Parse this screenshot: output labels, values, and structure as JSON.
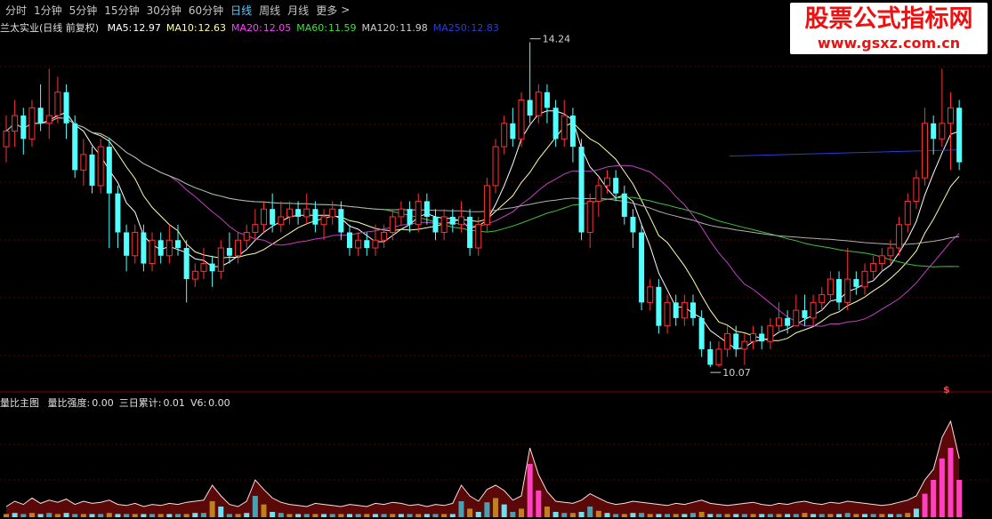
{
  "periods": [
    "分时",
    "1分钟",
    "5分钟",
    "15分钟",
    "30分钟",
    "60分钟",
    "日线",
    "周线",
    "月线",
    "更多"
  ],
  "active_period": "日线",
  "more_arrow": ">",
  "stock_title": "兰太实业(日线 前复权)",
  "ma": [
    {
      "label": "MA5:",
      "value": "12.97",
      "color": "#ffffff"
    },
    {
      "label": "MA10:",
      "value": "12.63",
      "color": "#ffffaa"
    },
    {
      "label": "MA20:",
      "value": "12.05",
      "color": "#ff40ff"
    },
    {
      "label": "MA60:",
      "value": "11.59",
      "color": "#40e040"
    },
    {
      "label": "MA120:",
      "value": "11.98",
      "color": "#d0d0d0"
    },
    {
      "label": "MA250:",
      "value": "12.83",
      "color": "#2a3fd0"
    }
  ],
  "high_mark": "14.24",
  "low_mark": "10.07",
  "indicator": {
    "name": "量比主图",
    "items": [
      {
        "label": "量比强度:",
        "value": "0.00"
      },
      {
        "label": "三日累计:",
        "value": "0.01"
      },
      {
        "label": "V6:",
        "value": "0.00"
      }
    ]
  },
  "signal_glyph": "$",
  "watermark": {
    "title": "股票公式指标网",
    "url": "www.gsxz.com.cn"
  },
  "chart_data": {
    "type": "candlestick",
    "price_axis": {
      "min": 9.9,
      "max": 14.35
    },
    "candles": [
      [
        12.9,
        13.1,
        13.3,
        12.7
      ],
      [
        13.1,
        13.3,
        13.5,
        12.9
      ],
      [
        13.3,
        13.0,
        13.4,
        12.8
      ],
      [
        13.0,
        13.4,
        13.5,
        12.9
      ],
      [
        13.4,
        13.2,
        13.7,
        13.1
      ],
      [
        13.2,
        13.3,
        13.9,
        13.0
      ],
      [
        13.3,
        13.6,
        13.8,
        13.2
      ],
      [
        13.6,
        13.2,
        13.7,
        13.0
      ],
      [
        13.2,
        12.6,
        13.3,
        12.5
      ],
      [
        12.6,
        12.8,
        13.0,
        12.4
      ],
      [
        12.8,
        12.4,
        12.9,
        12.3
      ],
      [
        12.4,
        12.9,
        13.0,
        12.3
      ],
      [
        12.9,
        12.3,
        13.0,
        11.6
      ],
      [
        12.3,
        11.8,
        12.4,
        11.6
      ],
      [
        11.8,
        11.5,
        11.9,
        11.3
      ],
      [
        11.5,
        11.8,
        11.9,
        11.4
      ],
      [
        11.8,
        11.4,
        11.9,
        11.3
      ],
      [
        11.4,
        11.7,
        11.8,
        11.3
      ],
      [
        11.7,
        11.5,
        11.8,
        11.4
      ],
      [
        11.5,
        11.7,
        11.9,
        11.4
      ],
      [
        11.7,
        11.6,
        11.9,
        11.5
      ],
      [
        11.6,
        11.2,
        11.7,
        10.9
      ],
      [
        11.2,
        11.3,
        11.4,
        11.1
      ],
      [
        11.3,
        11.4,
        11.6,
        11.2
      ],
      [
        11.4,
        11.3,
        11.5,
        11.1
      ],
      [
        11.3,
        11.6,
        11.7,
        11.2
      ],
      [
        11.6,
        11.5,
        11.8,
        11.4
      ],
      [
        11.5,
        11.7,
        11.8,
        11.4
      ],
      [
        11.7,
        11.8,
        11.9,
        11.6
      ],
      [
        11.8,
        11.9,
        12.1,
        11.7
      ],
      [
        11.9,
        12.1,
        12.2,
        11.8
      ],
      [
        12.1,
        11.9,
        12.3,
        11.8
      ],
      [
        11.9,
        12.0,
        12.2,
        11.8
      ],
      [
        12.0,
        12.1,
        12.2,
        11.9
      ],
      [
        12.1,
        12.0,
        12.2,
        11.9
      ],
      [
        12.0,
        12.1,
        12.3,
        11.9
      ],
      [
        12.1,
        11.9,
        12.2,
        11.8
      ],
      [
        11.9,
        12.0,
        12.1,
        11.7
      ],
      [
        12.0,
        12.1,
        12.2,
        11.9
      ],
      [
        12.1,
        11.8,
        12.2,
        11.7
      ],
      [
        11.8,
        11.6,
        11.9,
        11.5
      ],
      [
        11.6,
        11.7,
        11.8,
        11.5
      ],
      [
        11.7,
        11.6,
        11.8,
        11.5
      ],
      [
        11.6,
        11.7,
        11.9,
        11.5
      ],
      [
        11.7,
        11.8,
        11.9,
        11.6
      ],
      [
        11.8,
        12.0,
        12.1,
        11.7
      ],
      [
        12.0,
        12.1,
        12.2,
        11.9
      ],
      [
        12.1,
        11.9,
        12.2,
        11.8
      ],
      [
        11.9,
        12.2,
        12.3,
        11.8
      ],
      [
        12.2,
        12.0,
        12.3,
        11.9
      ],
      [
        12.0,
        11.8,
        12.1,
        11.7
      ],
      [
        11.8,
        12.0,
        12.1,
        11.7
      ],
      [
        12.0,
        11.9,
        12.1,
        11.8
      ],
      [
        11.9,
        12.0,
        12.2,
        11.8
      ],
      [
        12.0,
        11.6,
        12.1,
        11.5
      ],
      [
        11.6,
        11.9,
        12.0,
        11.5
      ],
      [
        11.9,
        12.4,
        12.5,
        11.8
      ],
      [
        12.4,
        12.9,
        13.0,
        12.3
      ],
      [
        12.9,
        13.2,
        13.3,
        12.8
      ],
      [
        13.2,
        13.0,
        13.4,
        12.9
      ],
      [
        13.0,
        13.5,
        13.6,
        12.9
      ],
      [
        13.5,
        13.3,
        14.24,
        13.2
      ],
      [
        13.3,
        13.6,
        13.7,
        13.2
      ],
      [
        13.6,
        13.4,
        13.7,
        13.2
      ],
      [
        13.4,
        13.0,
        13.5,
        12.9
      ],
      [
        13.0,
        13.3,
        13.5,
        12.9
      ],
      [
        13.3,
        12.9,
        13.4,
        12.7
      ],
      [
        12.9,
        11.8,
        13.0,
        11.7
      ],
      [
        11.8,
        12.2,
        12.3,
        11.6
      ],
      [
        12.2,
        12.4,
        12.5,
        12.0
      ],
      [
        12.4,
        12.5,
        12.6,
        12.3
      ],
      [
        12.5,
        12.3,
        12.6,
        12.2
      ],
      [
        12.3,
        12.0,
        12.4,
        11.9
      ],
      [
        12.0,
        11.8,
        12.1,
        11.6
      ],
      [
        11.8,
        10.9,
        11.9,
        10.8
      ],
      [
        10.9,
        11.1,
        11.2,
        10.8
      ],
      [
        11.1,
        10.6,
        11.2,
        10.5
      ],
      [
        10.6,
        10.9,
        11.0,
        10.5
      ],
      [
        10.9,
        10.7,
        11.0,
        10.6
      ],
      [
        10.7,
        10.9,
        11.0,
        10.6
      ],
      [
        10.9,
        10.7,
        11.0,
        10.6
      ],
      [
        10.7,
        10.3,
        10.8,
        10.2
      ],
      [
        10.3,
        10.1,
        10.4,
        10.07
      ],
      [
        10.1,
        10.3,
        10.4,
        10.07
      ],
      [
        10.3,
        10.5,
        10.6,
        10.2
      ],
      [
        10.5,
        10.3,
        10.6,
        10.2
      ],
      [
        10.3,
        10.4,
        10.5,
        10.1
      ],
      [
        10.4,
        10.5,
        10.6,
        10.3
      ],
      [
        10.5,
        10.4,
        10.6,
        10.3
      ],
      [
        10.4,
        10.6,
        10.7,
        10.3
      ],
      [
        10.6,
        10.7,
        10.9,
        10.5
      ],
      [
        10.7,
        10.6,
        10.8,
        10.5
      ],
      [
        10.6,
        10.8,
        11.0,
        10.6
      ],
      [
        10.8,
        10.7,
        11.0,
        10.6
      ],
      [
        10.7,
        10.9,
        11.0,
        10.6
      ],
      [
        10.9,
        11.0,
        11.1,
        10.8
      ],
      [
        11.0,
        11.2,
        11.3,
        10.9
      ],
      [
        11.2,
        10.9,
        11.3,
        10.8
      ],
      [
        10.9,
        11.2,
        11.6,
        10.8
      ],
      [
        11.2,
        11.1,
        11.3,
        11.0
      ],
      [
        11.1,
        11.3,
        11.4,
        11.0
      ],
      [
        11.3,
        11.4,
        11.5,
        11.2
      ],
      [
        11.4,
        11.5,
        11.6,
        11.3
      ],
      [
        11.5,
        11.6,
        11.7,
        11.4
      ],
      [
        11.6,
        11.9,
        12.0,
        11.5
      ],
      [
        11.9,
        12.2,
        12.3,
        11.8
      ],
      [
        12.2,
        12.5,
        12.6,
        12.1
      ],
      [
        12.5,
        13.2,
        13.4,
        12.4
      ],
      [
        13.2,
        13.0,
        13.3,
        12.8
      ],
      [
        13.0,
        13.2,
        13.9,
        12.9
      ],
      [
        13.2,
        13.4,
        13.6,
        12.6
      ],
      [
        13.4,
        12.7,
        13.5,
        12.6
      ]
    ],
    "volume_bars": [
      [
        1.0,
        0.3
      ],
      [
        1.5,
        0.4
      ],
      [
        1.2,
        0.3
      ],
      [
        1.8,
        0.4
      ],
      [
        1.3,
        0.3
      ],
      [
        1.6,
        0.4
      ],
      [
        1.4,
        0.3
      ],
      [
        1.7,
        0.4
      ],
      [
        1.2,
        0.3
      ],
      [
        1.5,
        0.3
      ],
      [
        1.3,
        0.3
      ],
      [
        1.4,
        0.3
      ],
      [
        1.6,
        0.4
      ],
      [
        1.2,
        0.3
      ],
      [
        1.1,
        0.3
      ],
      [
        1.3,
        0.3
      ],
      [
        1.0,
        0.3
      ],
      [
        1.2,
        0.3
      ],
      [
        1.1,
        0.3
      ],
      [
        1.3,
        0.3
      ],
      [
        1.2,
        0.3
      ],
      [
        1.4,
        0.3
      ],
      [
        1.5,
        0.4
      ],
      [
        1.6,
        0.4
      ],
      [
        3.0,
        1.5
      ],
      [
        2.0,
        1.0
      ],
      [
        1.2,
        0.3
      ],
      [
        1.0,
        0.3
      ],
      [
        1.5,
        0.4
      ],
      [
        3.5,
        2.0
      ],
      [
        2.6,
        1.2
      ],
      [
        1.8,
        0.5
      ],
      [
        1.4,
        0.4
      ],
      [
        1.2,
        0.3
      ],
      [
        1.1,
        0.3
      ],
      [
        1.0,
        0.3
      ],
      [
        1.3,
        0.3
      ],
      [
        1.2,
        0.3
      ],
      [
        1.1,
        0.3
      ],
      [
        1.0,
        0.3
      ],
      [
        1.2,
        0.3
      ],
      [
        1.1,
        0.3
      ],
      [
        1.0,
        0.3
      ],
      [
        1.3,
        0.3
      ],
      [
        1.2,
        0.3
      ],
      [
        1.4,
        0.3
      ],
      [
        1.3,
        0.3
      ],
      [
        1.1,
        0.3
      ],
      [
        1.2,
        0.3
      ],
      [
        1.0,
        0.3
      ],
      [
        1.2,
        0.3
      ],
      [
        1.1,
        0.3
      ],
      [
        1.3,
        0.3
      ],
      [
        3.0,
        1.5
      ],
      [
        2.0,
        0.8
      ],
      [
        1.5,
        0.5
      ],
      [
        2.6,
        1.4
      ],
      [
        3.0,
        1.8
      ],
      [
        2.5,
        1.2
      ],
      [
        1.6,
        0.5
      ],
      [
        2.0,
        0.8
      ],
      [
        6.5,
        5.0
      ],
      [
        4.0,
        2.5
      ],
      [
        2.4,
        1.0
      ],
      [
        1.5,
        0.5
      ],
      [
        1.4,
        0.4
      ],
      [
        1.3,
        0.4
      ],
      [
        1.6,
        0.5
      ],
      [
        2.2,
        1.0
      ],
      [
        1.8,
        0.6
      ],
      [
        1.4,
        0.4
      ],
      [
        1.2,
        0.3
      ],
      [
        1.3,
        0.3
      ],
      [
        1.5,
        0.4
      ],
      [
        1.4,
        0.4
      ],
      [
        1.3,
        0.3
      ],
      [
        1.2,
        0.3
      ],
      [
        1.1,
        0.3
      ],
      [
        1.3,
        0.3
      ],
      [
        1.2,
        0.3
      ],
      [
        1.4,
        0.4
      ],
      [
        1.6,
        0.5
      ],
      [
        1.3,
        0.3
      ],
      [
        1.2,
        0.3
      ],
      [
        1.1,
        0.3
      ],
      [
        1.2,
        0.3
      ],
      [
        1.3,
        0.3
      ],
      [
        1.4,
        0.3
      ],
      [
        1.2,
        0.3
      ],
      [
        1.1,
        0.3
      ],
      [
        1.3,
        0.3
      ],
      [
        1.2,
        0.3
      ],
      [
        1.4,
        0.3
      ],
      [
        1.5,
        0.4
      ],
      [
        1.3,
        0.3
      ],
      [
        1.2,
        0.3
      ],
      [
        1.4,
        0.3
      ],
      [
        1.3,
        0.3
      ],
      [
        1.5,
        0.4
      ],
      [
        1.4,
        0.3
      ],
      [
        1.3,
        0.3
      ],
      [
        1.2,
        0.3
      ],
      [
        1.1,
        0.3
      ],
      [
        1.2,
        0.3
      ],
      [
        1.4,
        0.3
      ],
      [
        1.6,
        0.4
      ],
      [
        2.0,
        0.8
      ],
      [
        3.5,
        2.2
      ],
      [
        4.5,
        3.5
      ],
      [
        7.5,
        5.5
      ],
      [
        9.0,
        6.5
      ],
      [
        5.5,
        3.5
      ]
    ]
  }
}
